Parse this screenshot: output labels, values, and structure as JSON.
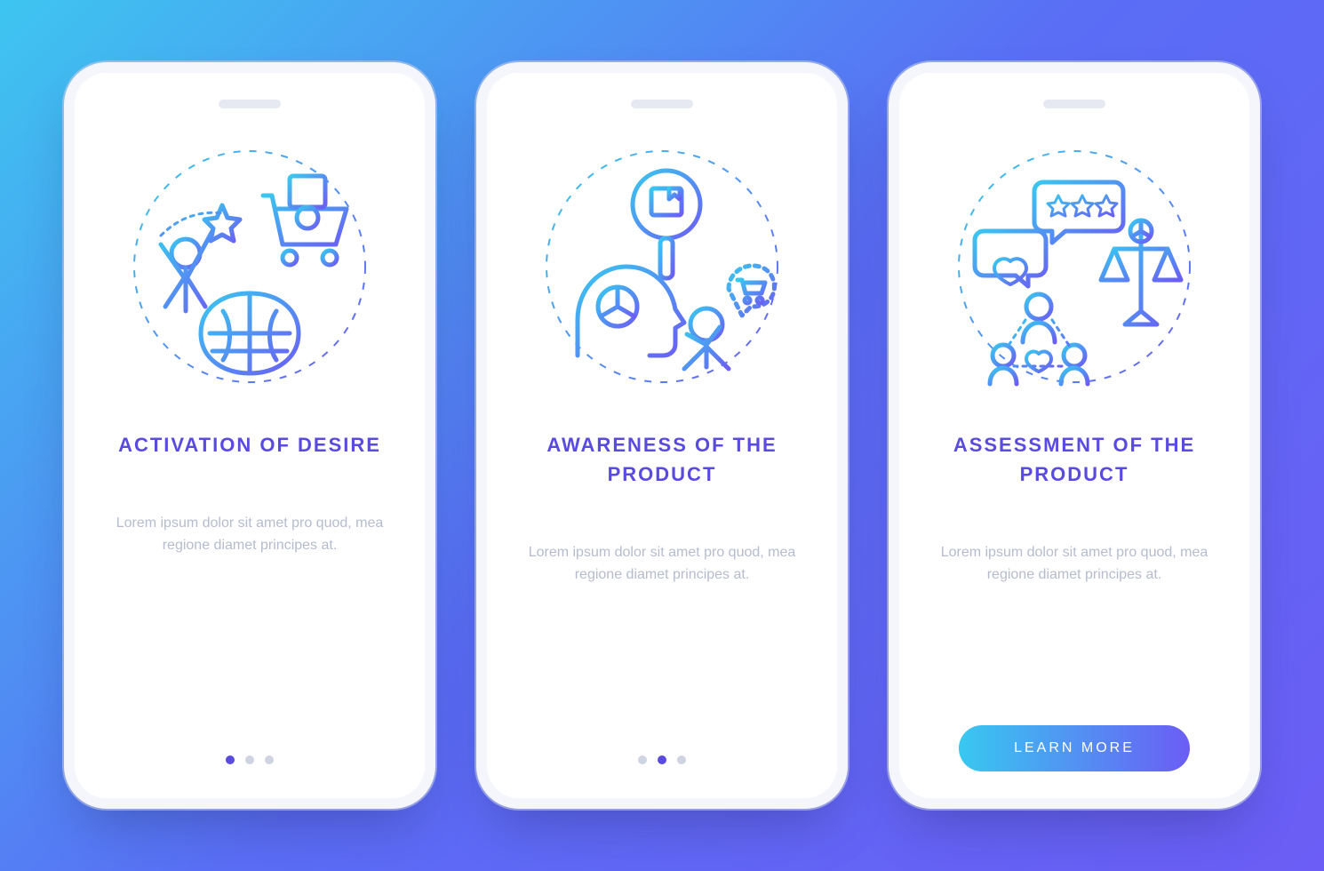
{
  "colors": {
    "gradient_start": "#3ec5f0",
    "gradient_end": "#6b5df5",
    "title": "#5a4be0",
    "desc": "#b6bccd",
    "dot_inactive": "#cfd4e3",
    "dot_active": "#5a4be0"
  },
  "screens": [
    {
      "id": "activation",
      "illustration": "desire-activation-icon",
      "title": "ACTIVATION OF DESIRE",
      "description": "Lorem ipsum dolor sit amet pro quod, mea regione diamet principes at.",
      "footer": {
        "type": "dots",
        "active_index": 0,
        "total": 3
      }
    },
    {
      "id": "awareness",
      "illustration": "product-awareness-icon",
      "title": "AWARENESS OF THE PRODUCT",
      "description": "Lorem ipsum dolor sit amet pro quod, mea regione diamet principes at.",
      "footer": {
        "type": "dots",
        "active_index": 1,
        "total": 3
      }
    },
    {
      "id": "assessment",
      "illustration": "product-assessment-icon",
      "title": "ASSESSMENT OF THE PRODUCT",
      "description": "Lorem ipsum dolor sit amet pro quod, mea regione diamet principes at.",
      "footer": {
        "type": "button",
        "label": "LEARN MORE"
      }
    }
  ]
}
